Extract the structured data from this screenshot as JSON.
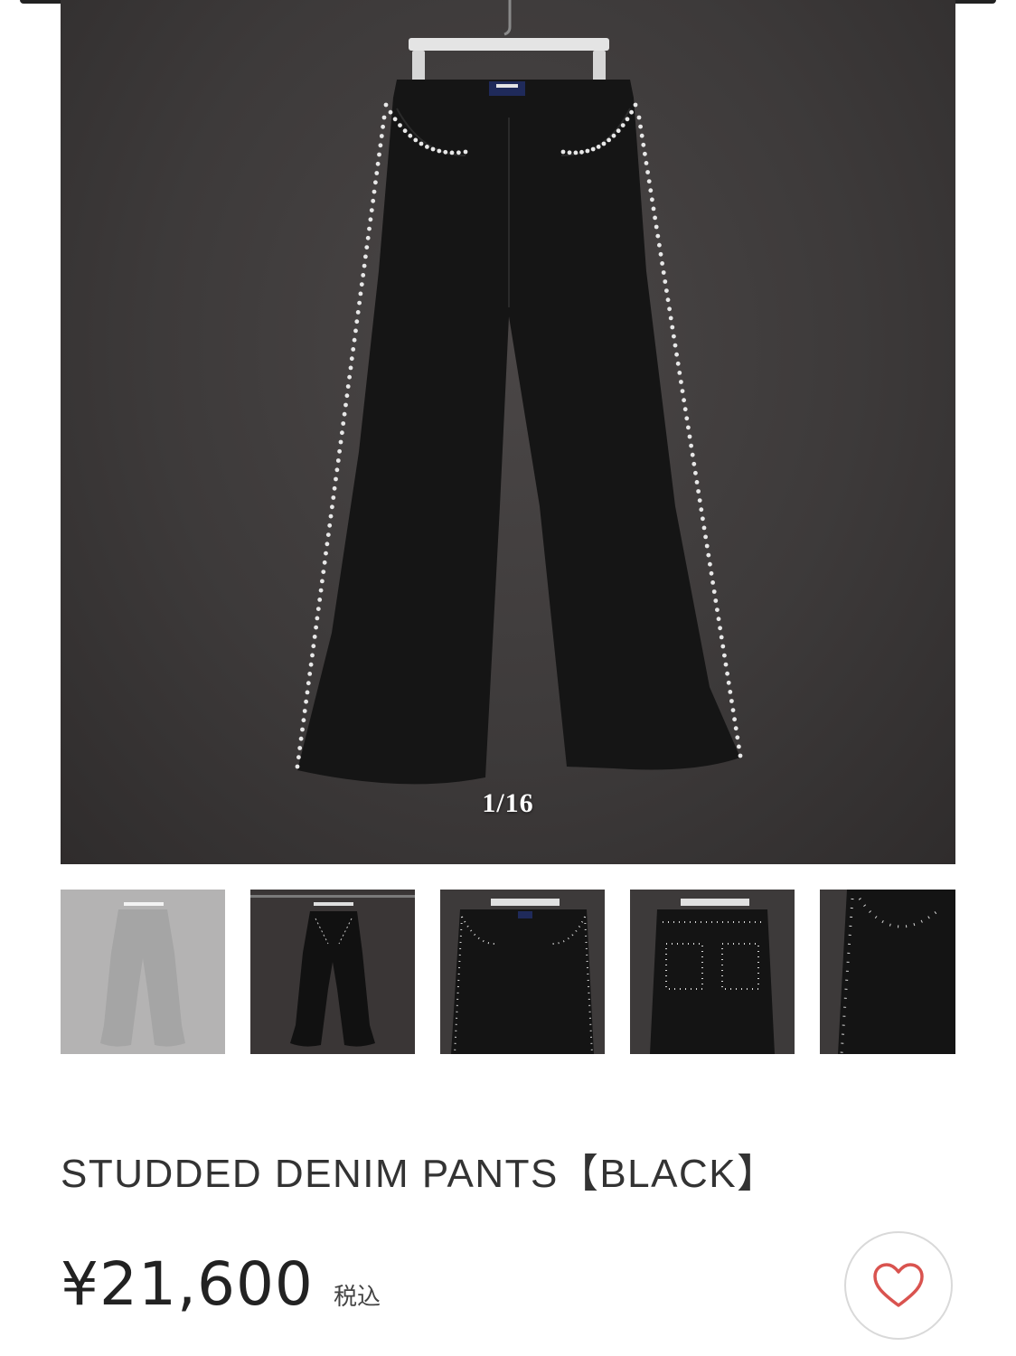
{
  "gallery": {
    "counter": "1/16",
    "main_image": "studded-denim-pants-front-hanging",
    "thumbnails": [
      {
        "name": "thumb-1",
        "subject": "pants-front-hanging",
        "active": true
      },
      {
        "name": "thumb-2",
        "subject": "pants-back-hanging",
        "active": false
      },
      {
        "name": "thumb-3",
        "subject": "pants-front-waist-closeup",
        "active": false
      },
      {
        "name": "thumb-4",
        "subject": "pants-back-pockets-closeup",
        "active": false
      },
      {
        "name": "thumb-5",
        "subject": "pants-pocket-studs-closeup",
        "active": false
      }
    ]
  },
  "product": {
    "title": "STUDDED DENIM PANTS【BLACK】",
    "price": "¥21,600",
    "tax_label": "税込"
  },
  "favorite": {
    "icon": "heart-icon",
    "color": "#d9534f"
  },
  "colors": {
    "background": "#ffffff",
    "image_backdrop": "#3d3a3a",
    "denim": "#141414",
    "stud": "#e8e8e8",
    "text": "#333333"
  }
}
